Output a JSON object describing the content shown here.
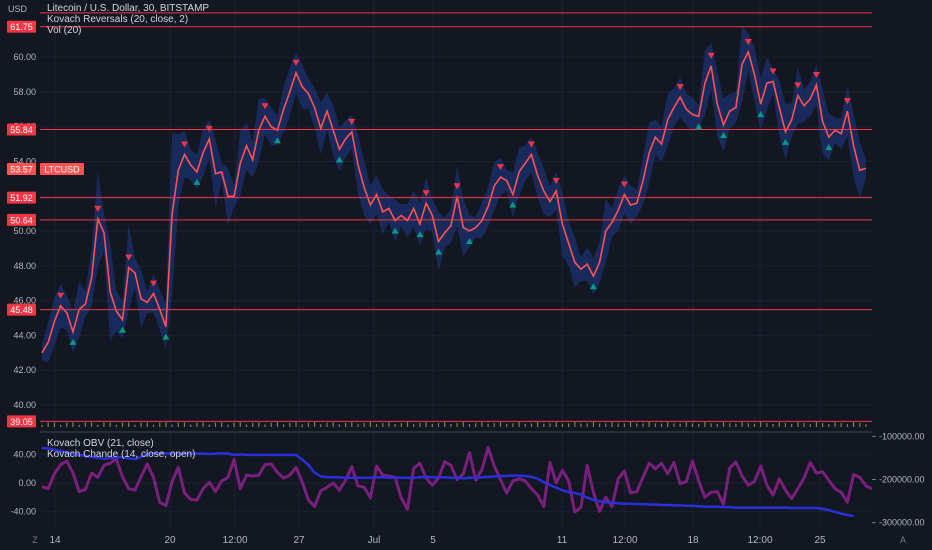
{
  "currency_label": "USD",
  "legend_main": [
    "Litecoin / U.S. Dollar, 30, BITSTAMP",
    "Kovach Reversals (20, close, 2)",
    "Vol (20)"
  ],
  "legend_sub": [
    "Kovach OBV (21, close)",
    "Kovach Chande (14, close, open)"
  ],
  "footer": {
    "z_label": "Z",
    "a_label": "A"
  },
  "colors": {
    "background": "#131722",
    "level_line": "#f23645",
    "price_line": "#ff5252",
    "band": "#1e3a8a",
    "obv": "#2b2fd9",
    "chande": "#7b1f7f",
    "arrow_up": "#089981",
    "arrow_down": "#f23645"
  },
  "chart_data": [
    {
      "type": "line",
      "title": "Litecoin / U.S. Dollar, 30, BITSTAMP",
      "ylabel": "USD",
      "ylim": [
        38.5,
        63.0
      ],
      "y_ticks": [
        40.0,
        42.0,
        44.0,
        46.0,
        48.0,
        50.0,
        52.0,
        54.0,
        56.0,
        58.0,
        60.0
      ],
      "x_ticks": [
        "14",
        "20",
        "12:00",
        "27",
        "Jul",
        "5",
        "11",
        "12:00",
        "18",
        "12:00",
        "25"
      ],
      "horizontal_levels": [
        62.55,
        61.75,
        55.84,
        51.92,
        50.64,
        45.48,
        39.05
      ],
      "level_labels": [
        "61.75",
        "55.84",
        "51.92",
        "50.64",
        "45.48",
        "39.05"
      ],
      "current_price": {
        "label": "53.57",
        "symbol": "LTCUSD",
        "value": 53.57
      },
      "series": [
        {
          "name": "LTCUSD",
          "values": [
            43.0,
            43.6,
            44.8,
            45.7,
            45.3,
            44.2,
            45.5,
            45.8,
            47.3,
            50.7,
            49.9,
            46.5,
            45.4,
            44.9,
            47.9,
            47.6,
            46.1,
            45.9,
            46.4,
            45.5,
            44.5,
            51.0,
            53.5,
            54.4,
            53.8,
            53.4,
            54.5,
            55.3,
            53.3,
            53.4,
            52.0,
            52.0,
            53.9,
            54.9,
            54.1,
            55.8,
            56.6,
            56.0,
            55.8,
            57.0,
            58.0,
            59.1,
            58.3,
            57.9,
            57.1,
            55.9,
            56.9,
            55.8,
            54.7,
            55.3,
            55.7,
            53.8,
            52.5,
            51.5,
            52.1,
            51.1,
            51.3,
            50.6,
            50.9,
            50.6,
            51.3,
            50.4,
            51.6,
            50.9,
            49.4,
            49.9,
            50.3,
            52.0,
            50.2,
            50.0,
            50.2,
            50.6,
            51.4,
            52.6,
            53.1,
            52.9,
            52.1,
            53.4,
            53.9,
            54.4,
            53.2,
            52.3,
            51.7,
            52.3,
            50.4,
            49.3,
            48.2,
            47.8,
            48.1,
            47.4,
            48.2,
            50.0,
            50.5,
            51.2,
            52.1,
            51.5,
            51.6,
            52.9,
            54.5,
            55.4,
            55.0,
            56.4,
            57.1,
            57.7,
            57.0,
            56.7,
            56.6,
            58.5,
            59.5,
            57.3,
            56.1,
            56.9,
            57.1,
            59.6,
            60.3,
            59.0,
            57.3,
            58.5,
            58.6,
            57.1,
            55.7,
            56.4,
            57.8,
            57.2,
            57.6,
            58.4,
            56.3,
            55.4,
            55.8,
            55.6,
            56.9,
            54.9,
            53.5,
            53.6
          ]
        },
        {
          "name": "Kovach OBV (21, close)",
          "ylim": [
            -310000,
            -90000
          ],
          "y_ticks": [
            -100000.0,
            -200000.0,
            -300000.0
          ],
          "values": [
            -127000,
            -128000,
            -131000,
            -134000,
            -137000,
            -140000,
            -143000,
            -146000,
            -148000,
            -150000,
            -152000,
            -150000,
            -149000,
            -148000,
            -151000,
            -153000,
            -148000,
            -141000,
            -140000,
            -139000,
            -139000,
            -140000,
            -141000,
            -140000,
            -140000,
            -140000,
            -140000,
            -141000,
            -140000,
            -139000,
            -140000,
            -143000,
            -142000,
            -143000,
            -143000,
            -143000,
            -143000,
            -143000,
            -143000,
            -143000,
            -143000,
            -143000,
            -154000,
            -166000,
            -184000,
            -193000,
            -195000,
            -195000,
            -195000,
            -196000,
            -196000,
            -196000,
            -196000,
            -196000,
            -195000,
            -195000,
            -196000,
            -196000,
            -196000,
            -196000,
            -196000,
            -195000,
            -194000,
            -195000,
            -195000,
            -195000,
            -196000,
            -196000,
            -197000,
            -196000,
            -196000,
            -195000,
            -194000,
            -193000,
            -192000,
            -192000,
            -191000,
            -191000,
            -192000,
            -194000,
            -198000,
            -206000,
            -213000,
            -219000,
            -225000,
            -229000,
            -231000,
            -235000,
            -242000,
            -247000,
            -250000,
            -253000,
            -254000,
            -255000,
            -256000,
            -256000,
            -257000,
            -257000,
            -258000,
            -258000,
            -259000,
            -259000,
            -260000,
            -260000,
            -261000,
            -261000,
            -262000,
            -263000,
            -263000,
            -263000,
            -264000,
            -264000,
            -265000,
            -265000,
            -265000,
            -265000,
            -265000,
            -265000,
            -265000,
            -265000,
            -265000,
            -266000,
            -266000,
            -266000,
            -266000,
            -266000,
            -268000,
            -271000,
            -275000,
            -279000,
            -282000,
            -285000
          ]
        },
        {
          "name": "Kovach Chande (14, close, open)",
          "ylim": [
            -62,
            72
          ],
          "y_ticks": [
            40.0,
            0.0,
            -40.0
          ],
          "values": [
            -5,
            -8,
            13,
            26,
            31,
            14,
            -12,
            -9,
            14,
            8,
            25,
            28,
            34,
            9,
            -8,
            -10,
            9,
            27,
            8,
            -27,
            -32,
            2,
            22,
            -14,
            -23,
            -24,
            -8,
            1,
            -12,
            3,
            8,
            33,
            -8,
            11,
            10,
            11,
            26,
            27,
            15,
            7,
            11,
            22,
            2,
            -24,
            -33,
            -11,
            -6,
            0,
            -10,
            4,
            23,
            -4,
            -6,
            -21,
            24,
            11,
            10,
            8,
            -21,
            -37,
            21,
            28,
            7,
            -3,
            7,
            30,
            25,
            5,
            13,
            43,
            4,
            19,
            50,
            24,
            5,
            -14,
            3,
            6,
            3,
            -8,
            -17,
            -33,
            29,
            0,
            18,
            3,
            -41,
            -34,
            25,
            -13,
            -40,
            -20,
            -33,
            6,
            17,
            -14,
            -12,
            8,
            28,
            20,
            28,
            13,
            29,
            -1,
            2,
            31,
            3,
            -20,
            -13,
            -12,
            -30,
            21,
            30,
            10,
            -3,
            2,
            24,
            -3,
            -17,
            6,
            -10,
            -22,
            -8,
            7,
            29,
            14,
            16,
            4,
            -8,
            -13,
            -27,
            12,
            8,
            -4,
            -8,
            0
          ]
        }
      ]
    }
  ]
}
